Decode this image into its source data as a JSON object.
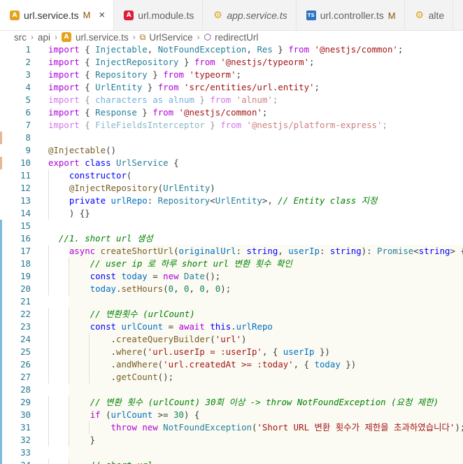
{
  "tabs": [
    {
      "label": "url.service.ts",
      "status": "M",
      "icon": "angular-service-icon",
      "active": true,
      "italic": false,
      "close": "×"
    },
    {
      "label": "url.module.ts",
      "status": "",
      "icon": "angular-module-icon",
      "active": false,
      "italic": false
    },
    {
      "label": "app.service.ts",
      "status": "",
      "icon": "gear-icon",
      "active": false,
      "italic": true
    },
    {
      "label": "url.controller.ts",
      "status": "M",
      "icon": "typescript-icon",
      "active": false,
      "italic": false
    },
    {
      "label": "alte",
      "status": "",
      "icon": "gear-icon",
      "active": false,
      "italic": false
    }
  ],
  "breadcrumb": [
    "src",
    "api",
    "url.service.ts",
    "UrlService",
    "redirectUrl"
  ],
  "editor": {
    "lines": [
      {
        "n": "1",
        "gutter": "",
        "text": "import { Injectable, NotFoundException, Res } from '@nestjs/common';"
      },
      {
        "n": "2",
        "gutter": "",
        "text": "import { InjectRepository } from '@nestjs/typeorm';"
      },
      {
        "n": "3",
        "gutter": "",
        "text": "import { Repository } from 'typeorm';"
      },
      {
        "n": "4",
        "gutter": "",
        "text": "import { UrlEntity } from 'src/entities/url.entity';"
      },
      {
        "n": "5",
        "gutter": "",
        "text": "import { characters as alnum } from 'alnum';"
      },
      {
        "n": "6",
        "gutter": "",
        "text": "import { Response } from '@nestjs/common';"
      },
      {
        "n": "7",
        "gutter": "",
        "text": "import { FileFieldsInterceptor } from '@nestjs/platform-express';"
      },
      {
        "n": "8",
        "gutter": "mod",
        "text": ""
      },
      {
        "n": "9",
        "gutter": "",
        "text": "@Injectable()"
      },
      {
        "n": "10",
        "gutter": "mod",
        "text": "export class UrlService {"
      },
      {
        "n": "11",
        "gutter": "",
        "text": "    constructor("
      },
      {
        "n": "12",
        "gutter": "",
        "text": "    @InjectRepository(UrlEntity)"
      },
      {
        "n": "13",
        "gutter": "",
        "text": "    private urlRepo: Repository<UrlEntity>, // Entity class 지정"
      },
      {
        "n": "14",
        "gutter": "",
        "text": "    ) {}"
      },
      {
        "n": "15",
        "gutter": "add",
        "text": ""
      },
      {
        "n": "16",
        "gutter": "add",
        "text": "  //1. short url 생성"
      },
      {
        "n": "17",
        "gutter": "add",
        "text": "    async createShortUrl(originalUrl: string, userIp: string): Promise<string> {"
      },
      {
        "n": "18",
        "gutter": "add",
        "text": "        // user ip 로 하루 short url 변환 횟수 확인"
      },
      {
        "n": "19",
        "gutter": "add",
        "text": "        const today = new Date();"
      },
      {
        "n": "20",
        "gutter": "add",
        "text": "        today.setHours(0, 0, 0, 0);"
      },
      {
        "n": "21",
        "gutter": "add",
        "text": ""
      },
      {
        "n": "22",
        "gutter": "add",
        "text": "        // 변환횟수 (urlCount)"
      },
      {
        "n": "23",
        "gutter": "add",
        "text": "        const urlCount = await this.urlRepo"
      },
      {
        "n": "24",
        "gutter": "add",
        "text": "            .createQueryBuilder('url')"
      },
      {
        "n": "25",
        "gutter": "add",
        "text": "            .where('url.userIp = :userIp', { userIp })"
      },
      {
        "n": "26",
        "gutter": "add",
        "text": "            .andWhere('url.createdAt >= :today', { today })"
      },
      {
        "n": "27",
        "gutter": "add",
        "text": "            .getCount();"
      },
      {
        "n": "28",
        "gutter": "add",
        "text": ""
      },
      {
        "n": "29",
        "gutter": "add",
        "text": "        // 변환 횟수 (urlCount) 30회 이상 -> throw NotFoundException (요청 제한)"
      },
      {
        "n": "30",
        "gutter": "add",
        "text": "        if (urlCount >= 30) {"
      },
      {
        "n": "31",
        "gutter": "add",
        "text": "            throw new NotFoundException('Short URL 변환 횟수가 제한을 초과하였습니다');"
      },
      {
        "n": "32",
        "gutter": "add",
        "text": "        }"
      },
      {
        "n": "33",
        "gutter": "add",
        "text": ""
      },
      {
        "n": "34",
        "gutter": "add",
        "text": "        // short url"
      }
    ]
  },
  "colors": {
    "keyword": "#af00db",
    "keyword_blue": "#0000ff",
    "variable": "#0070c1",
    "function": "#795e26",
    "string": "#a31515",
    "class": "#267f99",
    "comment": "#008000",
    "number": "#098658",
    "line_number": "#237893",
    "modified_marker": "#e6b796",
    "added_marker": "#7fb8de"
  }
}
